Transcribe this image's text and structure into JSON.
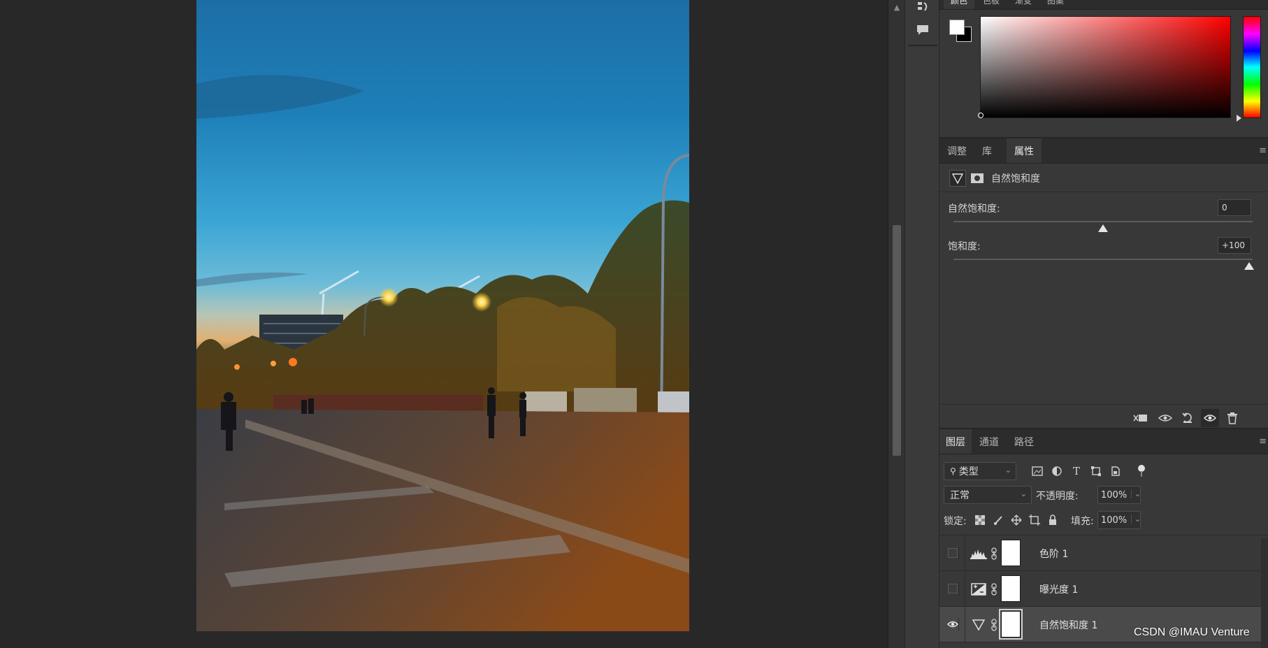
{
  "color_panel": {
    "tabs": [
      "颜色",
      "色板",
      "渐变",
      "图案"
    ],
    "foreground": "#ffffff",
    "background": "#000000",
    "hue": "#ff0000"
  },
  "properties_panel": {
    "tabs": [
      "调整",
      "库",
      "属性"
    ],
    "active_tab": "属性",
    "adjustment_title": "自然饱和度",
    "vibrance": {
      "label": "自然饱和度:",
      "value": "0",
      "level": 0.5
    },
    "saturation": {
      "label": "饱和度:",
      "value": "+100",
      "level": 1.0
    }
  },
  "layers_panel": {
    "tabs": [
      "图层",
      "通道",
      "路径"
    ],
    "active_tab": "图层",
    "filter_kind": "类型",
    "blend_mode": "正常",
    "opacity_label": "不透明度:",
    "opacity_value": "100%",
    "lock_label": "锁定:",
    "fill_label": "填充:",
    "fill_value": "100%",
    "layers": [
      {
        "name": "色阶 1",
        "icon": "levels-icon",
        "visible": false,
        "selected": false
      },
      {
        "name": "曝光度 1",
        "icon": "exposure-icon",
        "visible": false,
        "selected": false
      },
      {
        "name": "自然饱和度 1",
        "icon": "vibrance-icon",
        "visible": true,
        "selected": true
      }
    ]
  },
  "watermark": "CSDN @IMAU Venture",
  "colors": {
    "panel_bg": "#383838",
    "canvas_bg": "#282828",
    "selected_row": "#4a4a4a"
  }
}
